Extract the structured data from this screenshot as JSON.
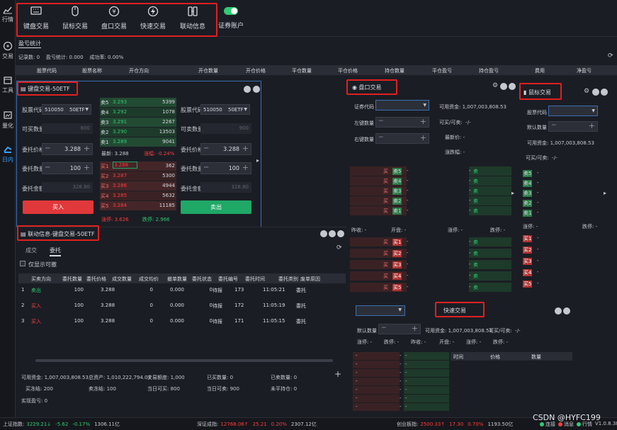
{
  "sidebar": {
    "items": [
      "行情",
      "交易",
      "工具",
      "量化",
      "日内"
    ]
  },
  "toolbar": {
    "items": [
      "键盘交易",
      "鼠标交易",
      "盘口交易",
      "快速交易",
      "联动信息",
      "证券账户"
    ]
  },
  "pnl": {
    "tab": "盈亏统计",
    "stats": "记录数: 0    盈亏统计: 0.000    成功率: 0.00%",
    "cols": [
      "股票代码",
      "股票名称",
      "开仓方向",
      "开仓数量",
      "开仓价格",
      "平仓数量",
      "平仓价格",
      "持仓数量",
      "平仓盈亏",
      "持仓盈亏",
      "费用",
      "净盈亏"
    ]
  },
  "kb": {
    "title": "键盘交易-50ETF",
    "left": {
      "code_label": "股票代码",
      "code": "510050",
      "name": "50ETF",
      "avail_label": "可买数量",
      "avail": "800",
      "price_label": "委托价格",
      "price": "3.288",
      "qty_label": "委托数量",
      "qty": "100",
      "amount_label": "委托金额",
      "amount": "328.80",
      "button": "买入"
    },
    "right": {
      "code_label": "股票代码",
      "code": "510050",
      "name": "50ETF",
      "avail_label": "可卖数量",
      "avail": "900",
      "price_label": "委托价格",
      "price": "3.288",
      "qty_label": "委托数量",
      "qty": "100",
      "amount_label": "委托金额",
      "amount": "328.80",
      "button": "卖出"
    },
    "asks": [
      {
        "l": "卖5",
        "p": "3.293",
        "v": "5399"
      },
      {
        "l": "卖4",
        "p": "3.292",
        "v": "1078"
      },
      {
        "l": "卖3",
        "p": "3.291",
        "v": "2267"
      },
      {
        "l": "卖2",
        "p": "3.290",
        "v": "13503"
      },
      {
        "l": "卖1",
        "p": "3.289",
        "v": "9041"
      }
    ],
    "last": "最新: 3.288",
    "chg": "涨幅: -0.24%",
    "bids": [
      {
        "l": "买1",
        "p": "3.288",
        "v": "362"
      },
      {
        "l": "买2",
        "p": "3.287",
        "v": "5300"
      },
      {
        "l": "买3",
        "p": "3.286",
        "v": "4944"
      },
      {
        "l": "买4",
        "p": "3.285",
        "v": "5632"
      },
      {
        "l": "买5",
        "p": "3.284",
        "v": "11185"
      }
    ],
    "zt": "涨停: 3.626",
    "dt": "跌停: 2.966"
  },
  "link": {
    "title": "联动信息-键盘交易-50ETF",
    "tabs": [
      "成交",
      "委托"
    ],
    "checkbox": "仅显示可撤",
    "cols": [
      "买卖方向",
      "委托数量",
      "委托价格",
      "成交数量",
      "成交均价",
      "撤单数量",
      "委托状态",
      "委托编号",
      "委托时间",
      "委托类别",
      "废单原因"
    ],
    "rows": [
      [
        "1",
        "卖出",
        "100",
        "3.288",
        "0",
        "0.000",
        "0",
        "待报",
        "173",
        "11:05:21",
        "委托"
      ],
      [
        "2",
        "买入",
        "100",
        "3.288",
        "0",
        "0.000",
        "0",
        "待报",
        "172",
        "11:05:19",
        "委托"
      ],
      [
        "3",
        "买入",
        "100",
        "3.288",
        "0",
        "0.000",
        "0",
        "待报",
        "171",
        "11:05:15",
        "委托"
      ]
    ],
    "f1": [
      "可用资金: 1,007,003,808.53",
      "总资产: 1,010,222,794.03",
      "交易额度: 1,000",
      "已买数量: 0",
      "已卖数量: 0"
    ],
    "f2": [
      "买冻结: 200",
      "卖冻结: 100",
      "当日可买: 800",
      "当日可卖: 900",
      "未平持仓: 0"
    ],
    "f3": "实现盈亏: 0"
  },
  "pk": {
    "title": "盘口交易",
    "code_label": "证券代码",
    "left_label": "左键数量",
    "right_label": "右键数量",
    "cash": "可用资金: 1,007,003,808.53",
    "avail": "可买/可卖:  -/-",
    "last": "最新价: -",
    "chg": "涨跌幅: -",
    "asks": [
      "卖5",
      "卖4",
      "卖3",
      "卖2",
      "卖1"
    ],
    "mid": [
      "昨收: -",
      "开盘: -",
      "涨停: -",
      "跌停: -"
    ],
    "bids": [
      "买1",
      "买2",
      "买3",
      "买4",
      "买5"
    ],
    "dash": "-",
    "buy": "买",
    "sell": "卖"
  },
  "ms": {
    "title": "鼠标交易",
    "code_label": "股票代码",
    "qty_label": "默认数量",
    "cash": "可用资金: 1,007,003,808.53",
    "avail": "可买/可卖:  -/-",
    "asks": [
      "卖5",
      "卖4",
      "卖3",
      "卖2",
      "卖1"
    ],
    "zt": "涨停: -",
    "dt": "跌停: -",
    "bids": [
      "买1",
      "买2",
      "买3",
      "买4",
      "买5"
    ],
    "dash": "-"
  },
  "qk": {
    "title": "快速交易",
    "qty_label": "默认数量",
    "cash": "可用资金: 1,007,003,808.53",
    "avail": "可买/可卖:  -/-",
    "line": [
      "涨停: -",
      "跌停: -",
      "昨收: -",
      "开盘: -",
      "涨停: -",
      "跌停: -"
    ],
    "cols": [
      "时间",
      "价格",
      "数量"
    ],
    "dash": "-"
  },
  "status": {
    "items": [
      {
        "k": "上证指数:",
        "v": "3229.21↓",
        "c": "-5.62",
        "p": "-0.17%",
        "a": "1306.11亿"
      },
      {
        "k": "深证成指:",
        "v": "12768.06↑",
        "c": "25.21",
        "p": "0.20%",
        "a": "2307.12亿"
      },
      {
        "k": "创业板指:",
        "v": "2500.33↑",
        "c": "17.30",
        "p": "0.70%",
        "a": "1193.50亿"
      }
    ],
    "legend": [
      "连接",
      "消息",
      "行情"
    ],
    "version": "V1.0.8.38",
    "watermark": "CSDN @HYFC199"
  }
}
